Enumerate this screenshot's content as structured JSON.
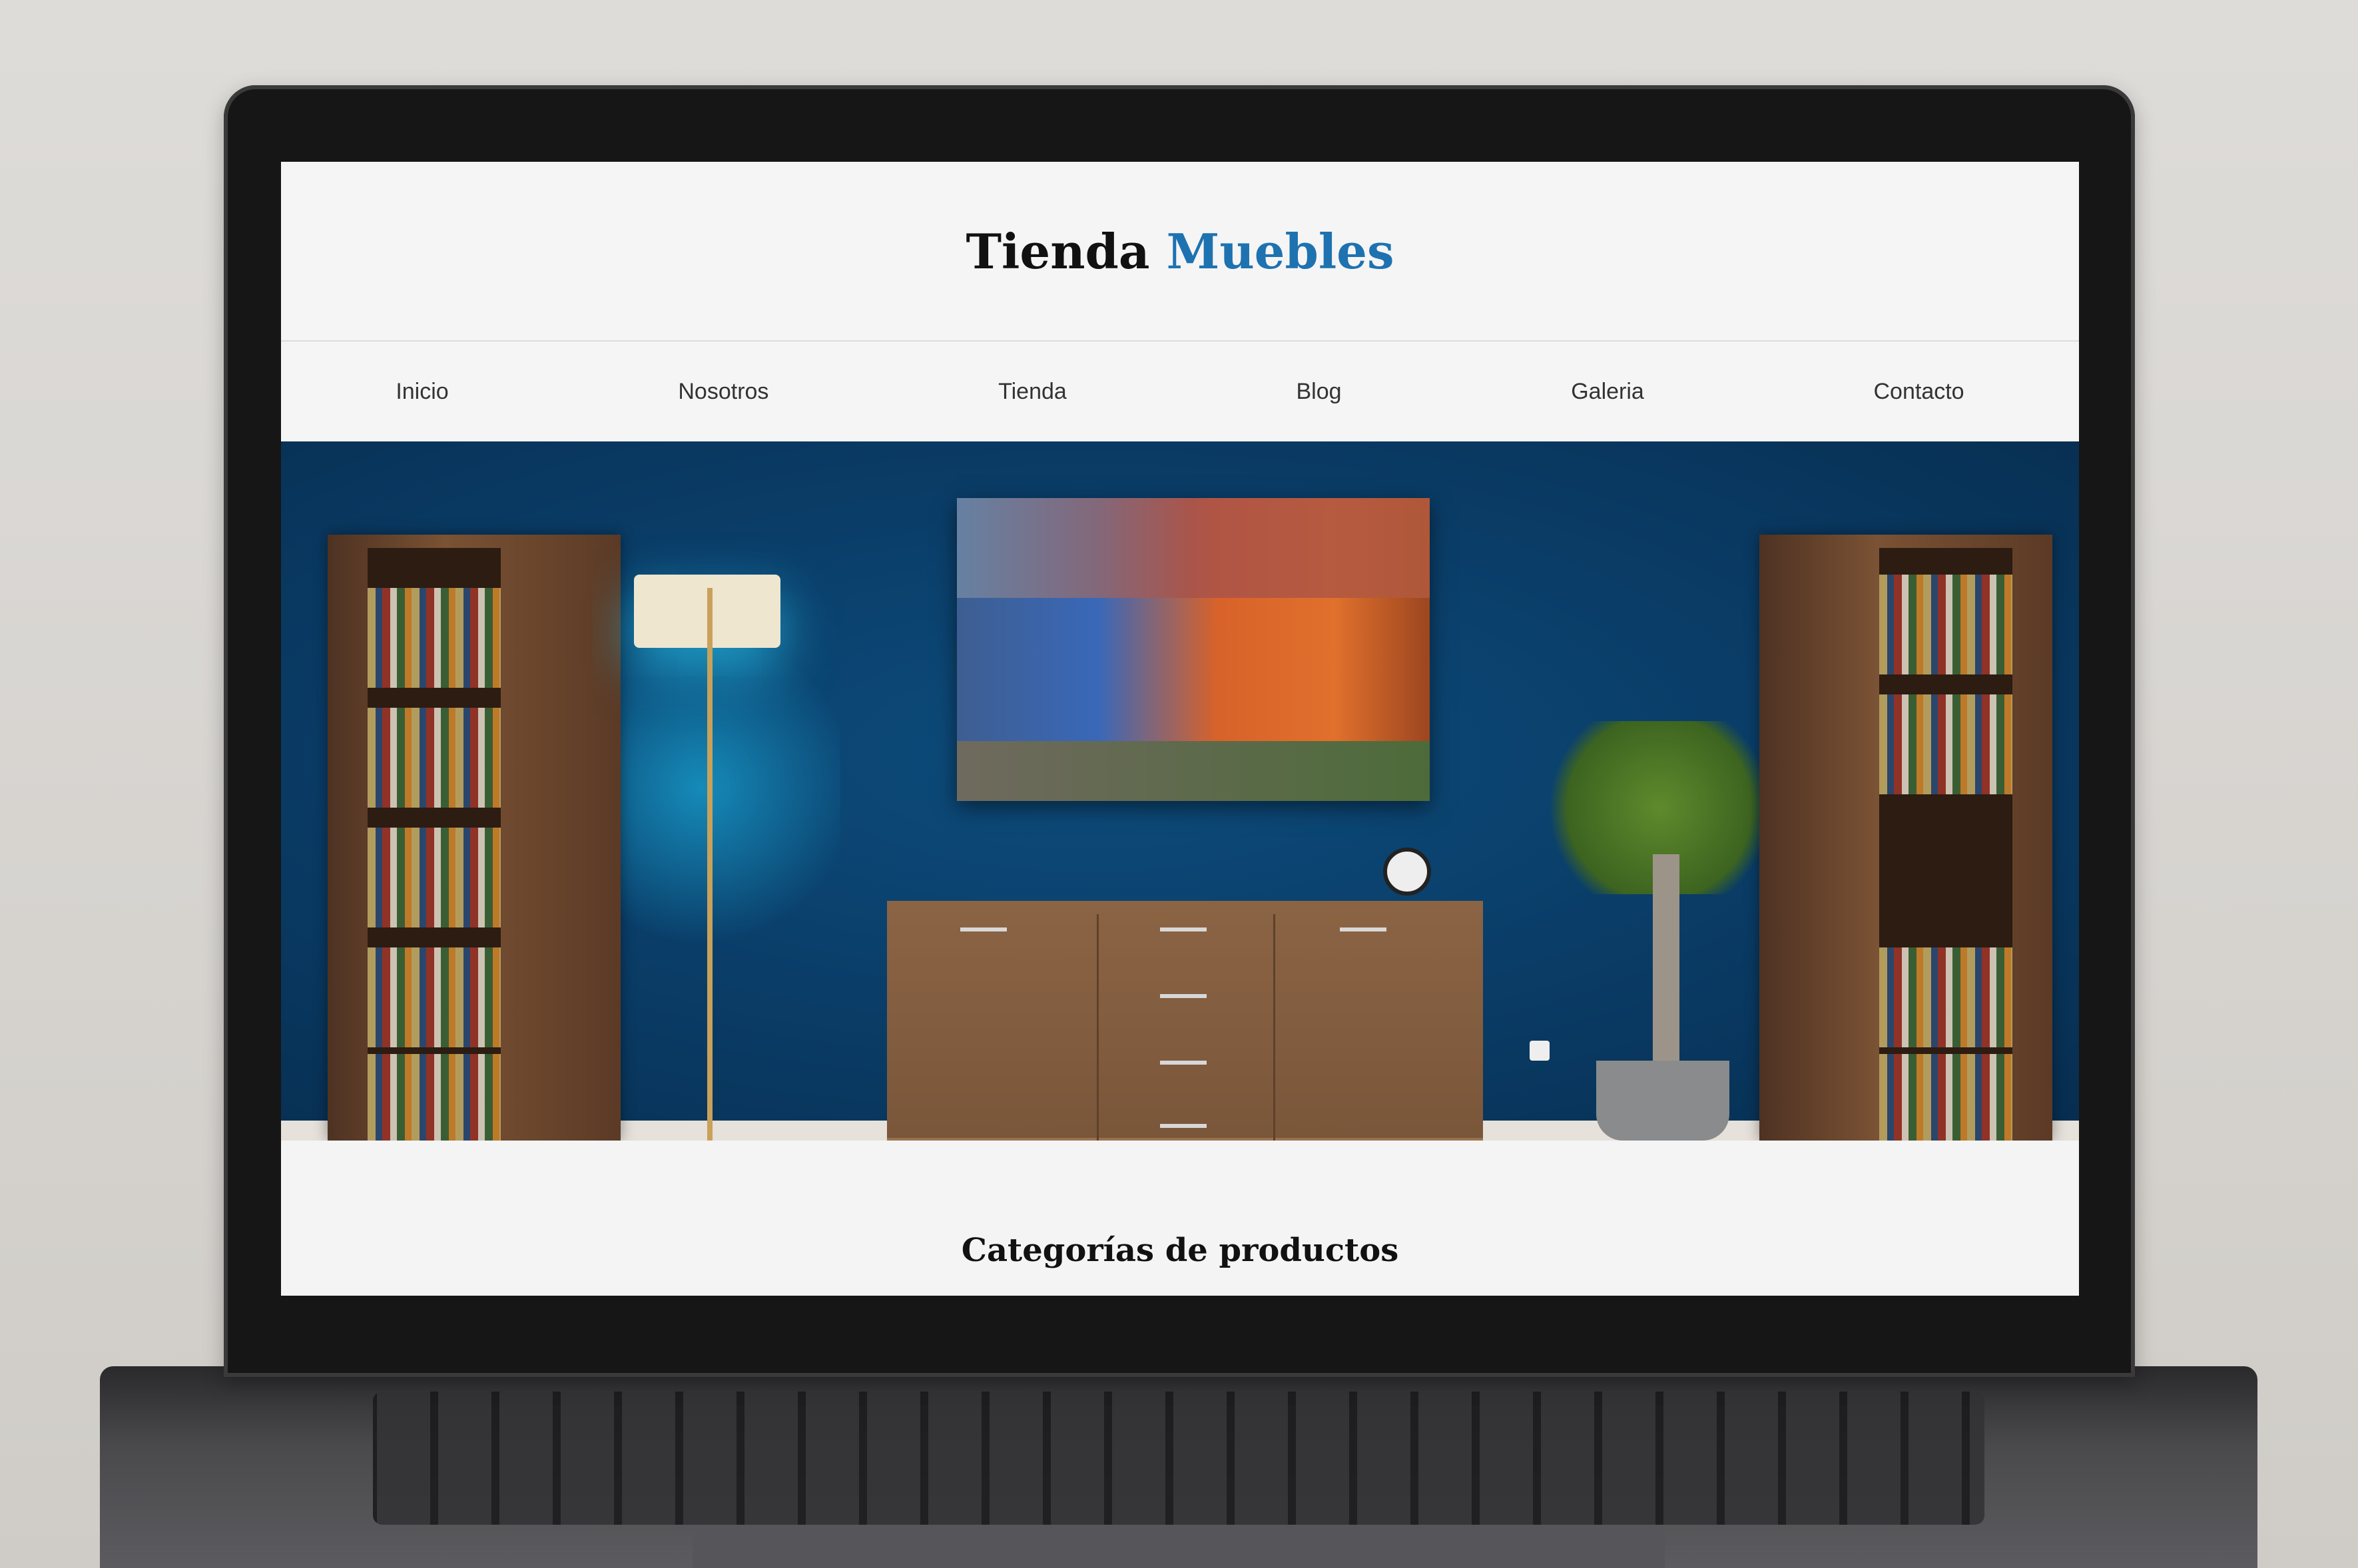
{
  "site": {
    "logo_part1": "Tienda",
    "logo_part2": "Muebles",
    "logo_accent_color": "#1e72b0"
  },
  "nav": {
    "items": [
      {
        "label": "Inicio"
      },
      {
        "label": "Nosotros"
      },
      {
        "label": "Tienda"
      },
      {
        "label": "Blog"
      },
      {
        "label": "Galeria"
      },
      {
        "label": "Contacto"
      }
    ]
  },
  "hero": {
    "image_description": "living-room-hero"
  },
  "sections": {
    "categories_title": "Categorías de productos"
  }
}
